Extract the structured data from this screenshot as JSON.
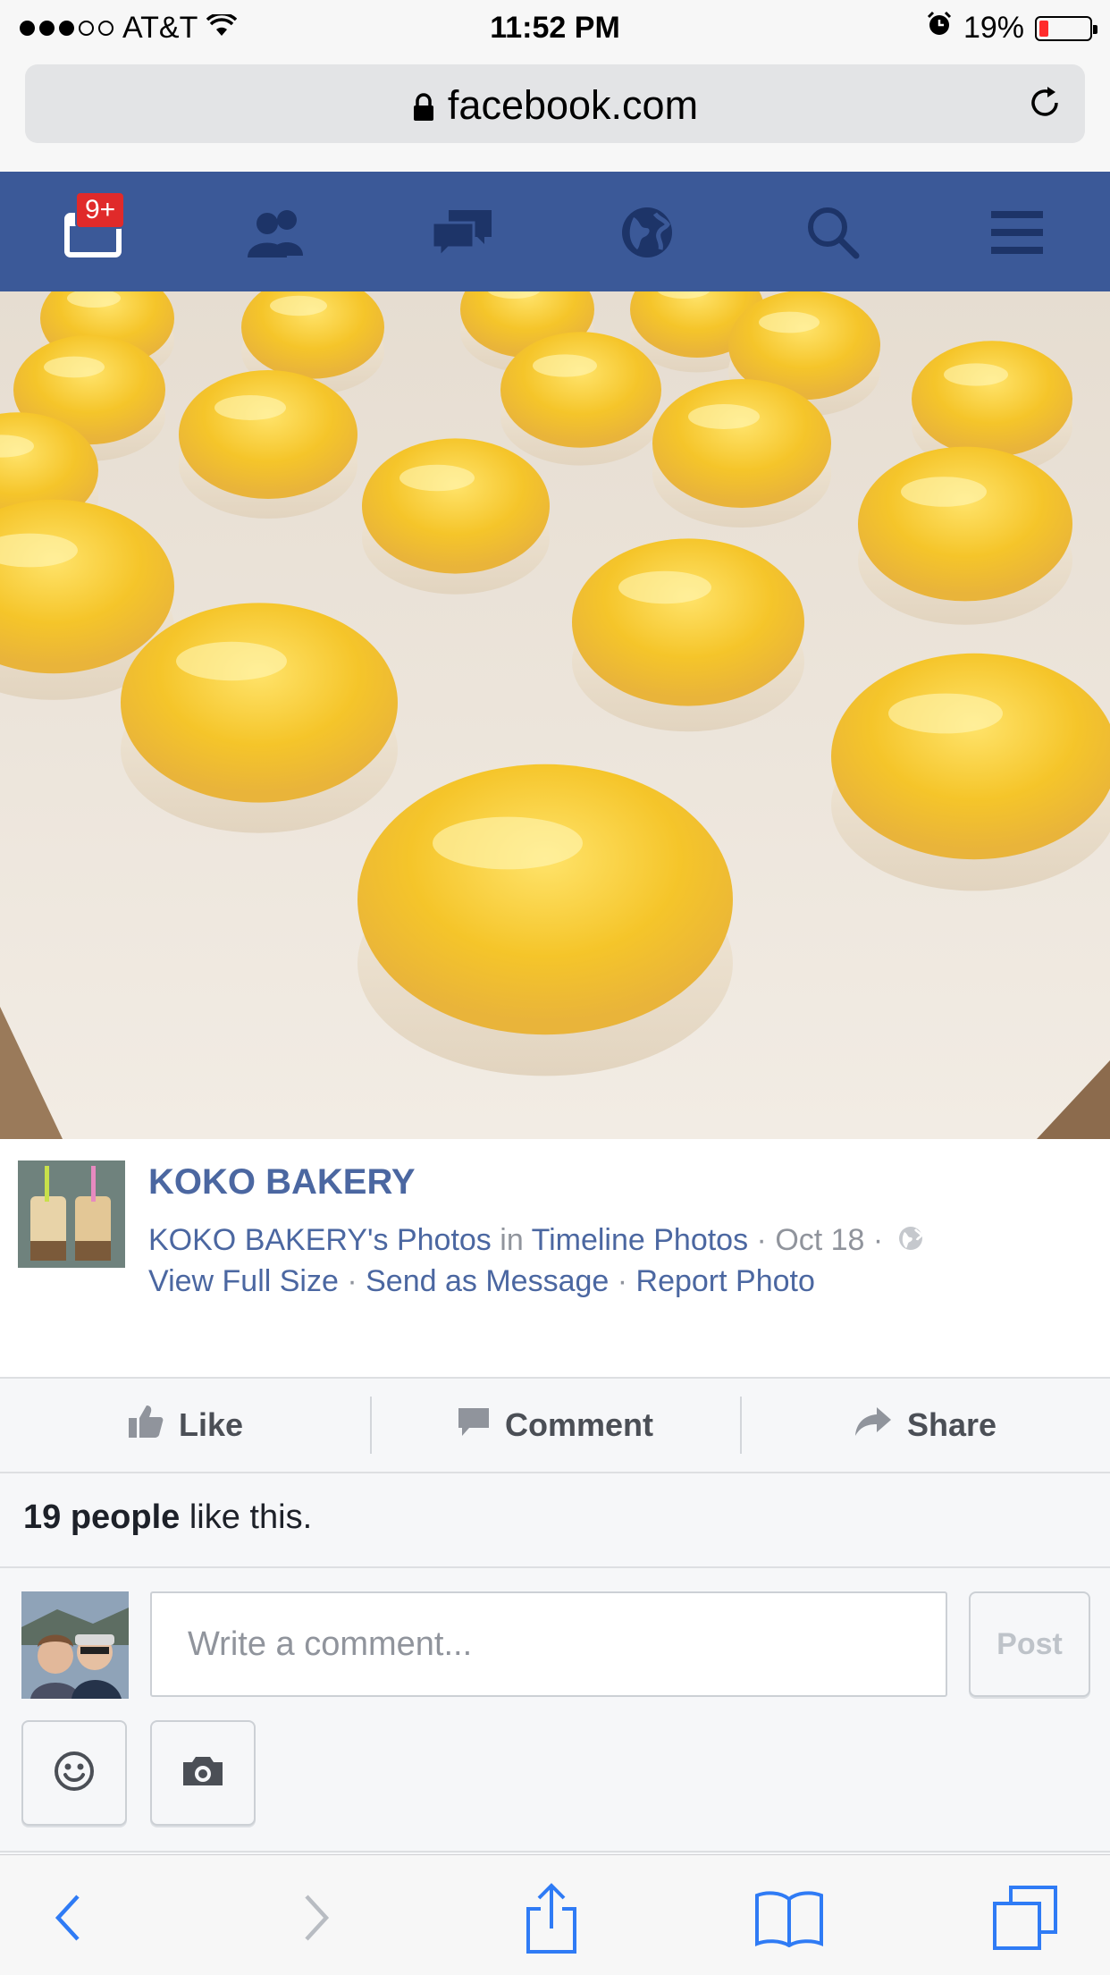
{
  "status_bar": {
    "carrier": "AT&T",
    "time": "11:52 PM",
    "battery": "19%",
    "battery_level": 0.19,
    "signal_bars_filled": 3,
    "signal_bars_total": 5
  },
  "url_bar": {
    "domain": "facebook.com"
  },
  "fb_nav": {
    "notification_badge": "9+",
    "icons": [
      "notifications-icon",
      "friends-icon",
      "messages-icon",
      "globe-icon",
      "search-icon",
      "menu-icon"
    ],
    "bar_color": "#3b5998"
  },
  "photo": {
    "subject": "glazed baked pastries on a tray"
  },
  "post": {
    "page_name": "KOKO BAKERY",
    "album_owner": "KOKO BAKERY's Photos",
    "in_word": "in",
    "album": "Timeline Photos",
    "separator": " · ",
    "date": "Oct 18",
    "privacy_icon": "public-globe-icon",
    "links": [
      "View Full Size",
      "Send as Message",
      "Report Photo"
    ]
  },
  "actions": {
    "like": "Like",
    "comment": "Comment",
    "share": "Share"
  },
  "likes": {
    "count_text": "19 people",
    "suffix": " like this."
  },
  "composer": {
    "placeholder": "Write a comment...",
    "post_label": "Post"
  },
  "safari_toolbar": {
    "icons": [
      "back-icon",
      "forward-icon",
      "share-icon",
      "bookmarks-icon",
      "tabs-icon"
    ]
  }
}
